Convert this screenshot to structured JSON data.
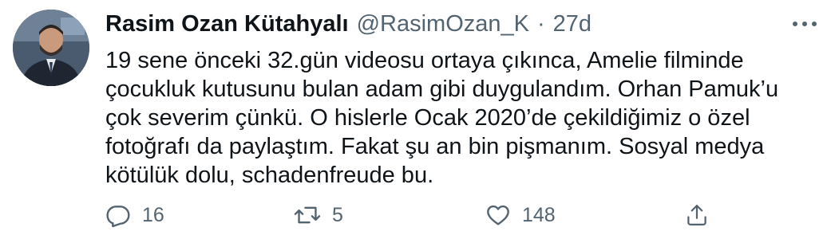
{
  "author": {
    "display_name": "Rasim Ozan Kütahyalı",
    "handle": "@RasimOzan_K",
    "separator": "·",
    "time": "27d"
  },
  "tweet": {
    "text": "19 sene önceki 32.gün videosu ortaya çıkınca, Amelie filminde\nçocukluk kutusunu bulan adam gibi duygulandım. Orhan Pamuk’u\nçok severim çünkü. O hislerle Ocak 2020’de çekildiğimiz o özel\nfotoğrafı da paylaştım. Fakat şu an bin pişmanım. Sosyal medya\nkötülük dolu, schadenfreude bu."
  },
  "actions": {
    "reply": {
      "icon": "reply-icon",
      "count": "16"
    },
    "retweet": {
      "icon": "retweet-icon",
      "count": "5"
    },
    "like": {
      "icon": "heart-icon",
      "count": "148"
    },
    "share": {
      "icon": "share-icon"
    }
  },
  "more": {
    "icon": "more-options-icon"
  },
  "colors": {
    "text": "#0f1419",
    "secondary": "#536471",
    "background": "#ffffff"
  }
}
